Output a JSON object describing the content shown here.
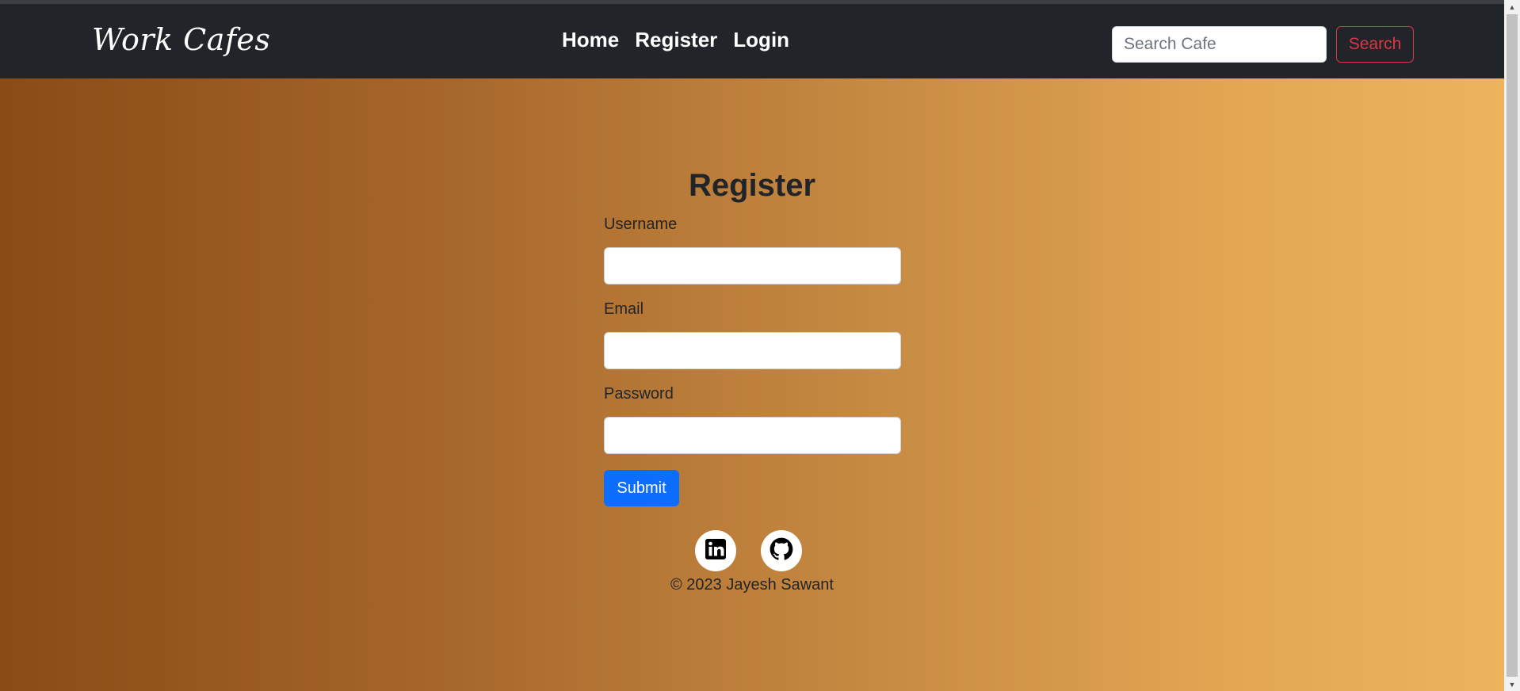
{
  "navbar": {
    "brand": "Work Cafes",
    "links": [
      "Home",
      "Register",
      "Login"
    ],
    "search_placeholder": "Search Cafe",
    "search_button": "Search"
  },
  "form": {
    "title": "Register",
    "username_label": "Username",
    "email_label": "Email",
    "password_label": "Password",
    "submit_label": "Submit"
  },
  "footer": {
    "icons": [
      "linkedin-icon",
      "github-icon"
    ],
    "copyright": "© 2023 Jayesh Sawant"
  },
  "colors": {
    "navbar_bg": "#212529",
    "gradient_start": "#8a4b15",
    "gradient_end": "#edb35e",
    "submit_button": "#0d6efd",
    "search_button": "#dc3545"
  }
}
